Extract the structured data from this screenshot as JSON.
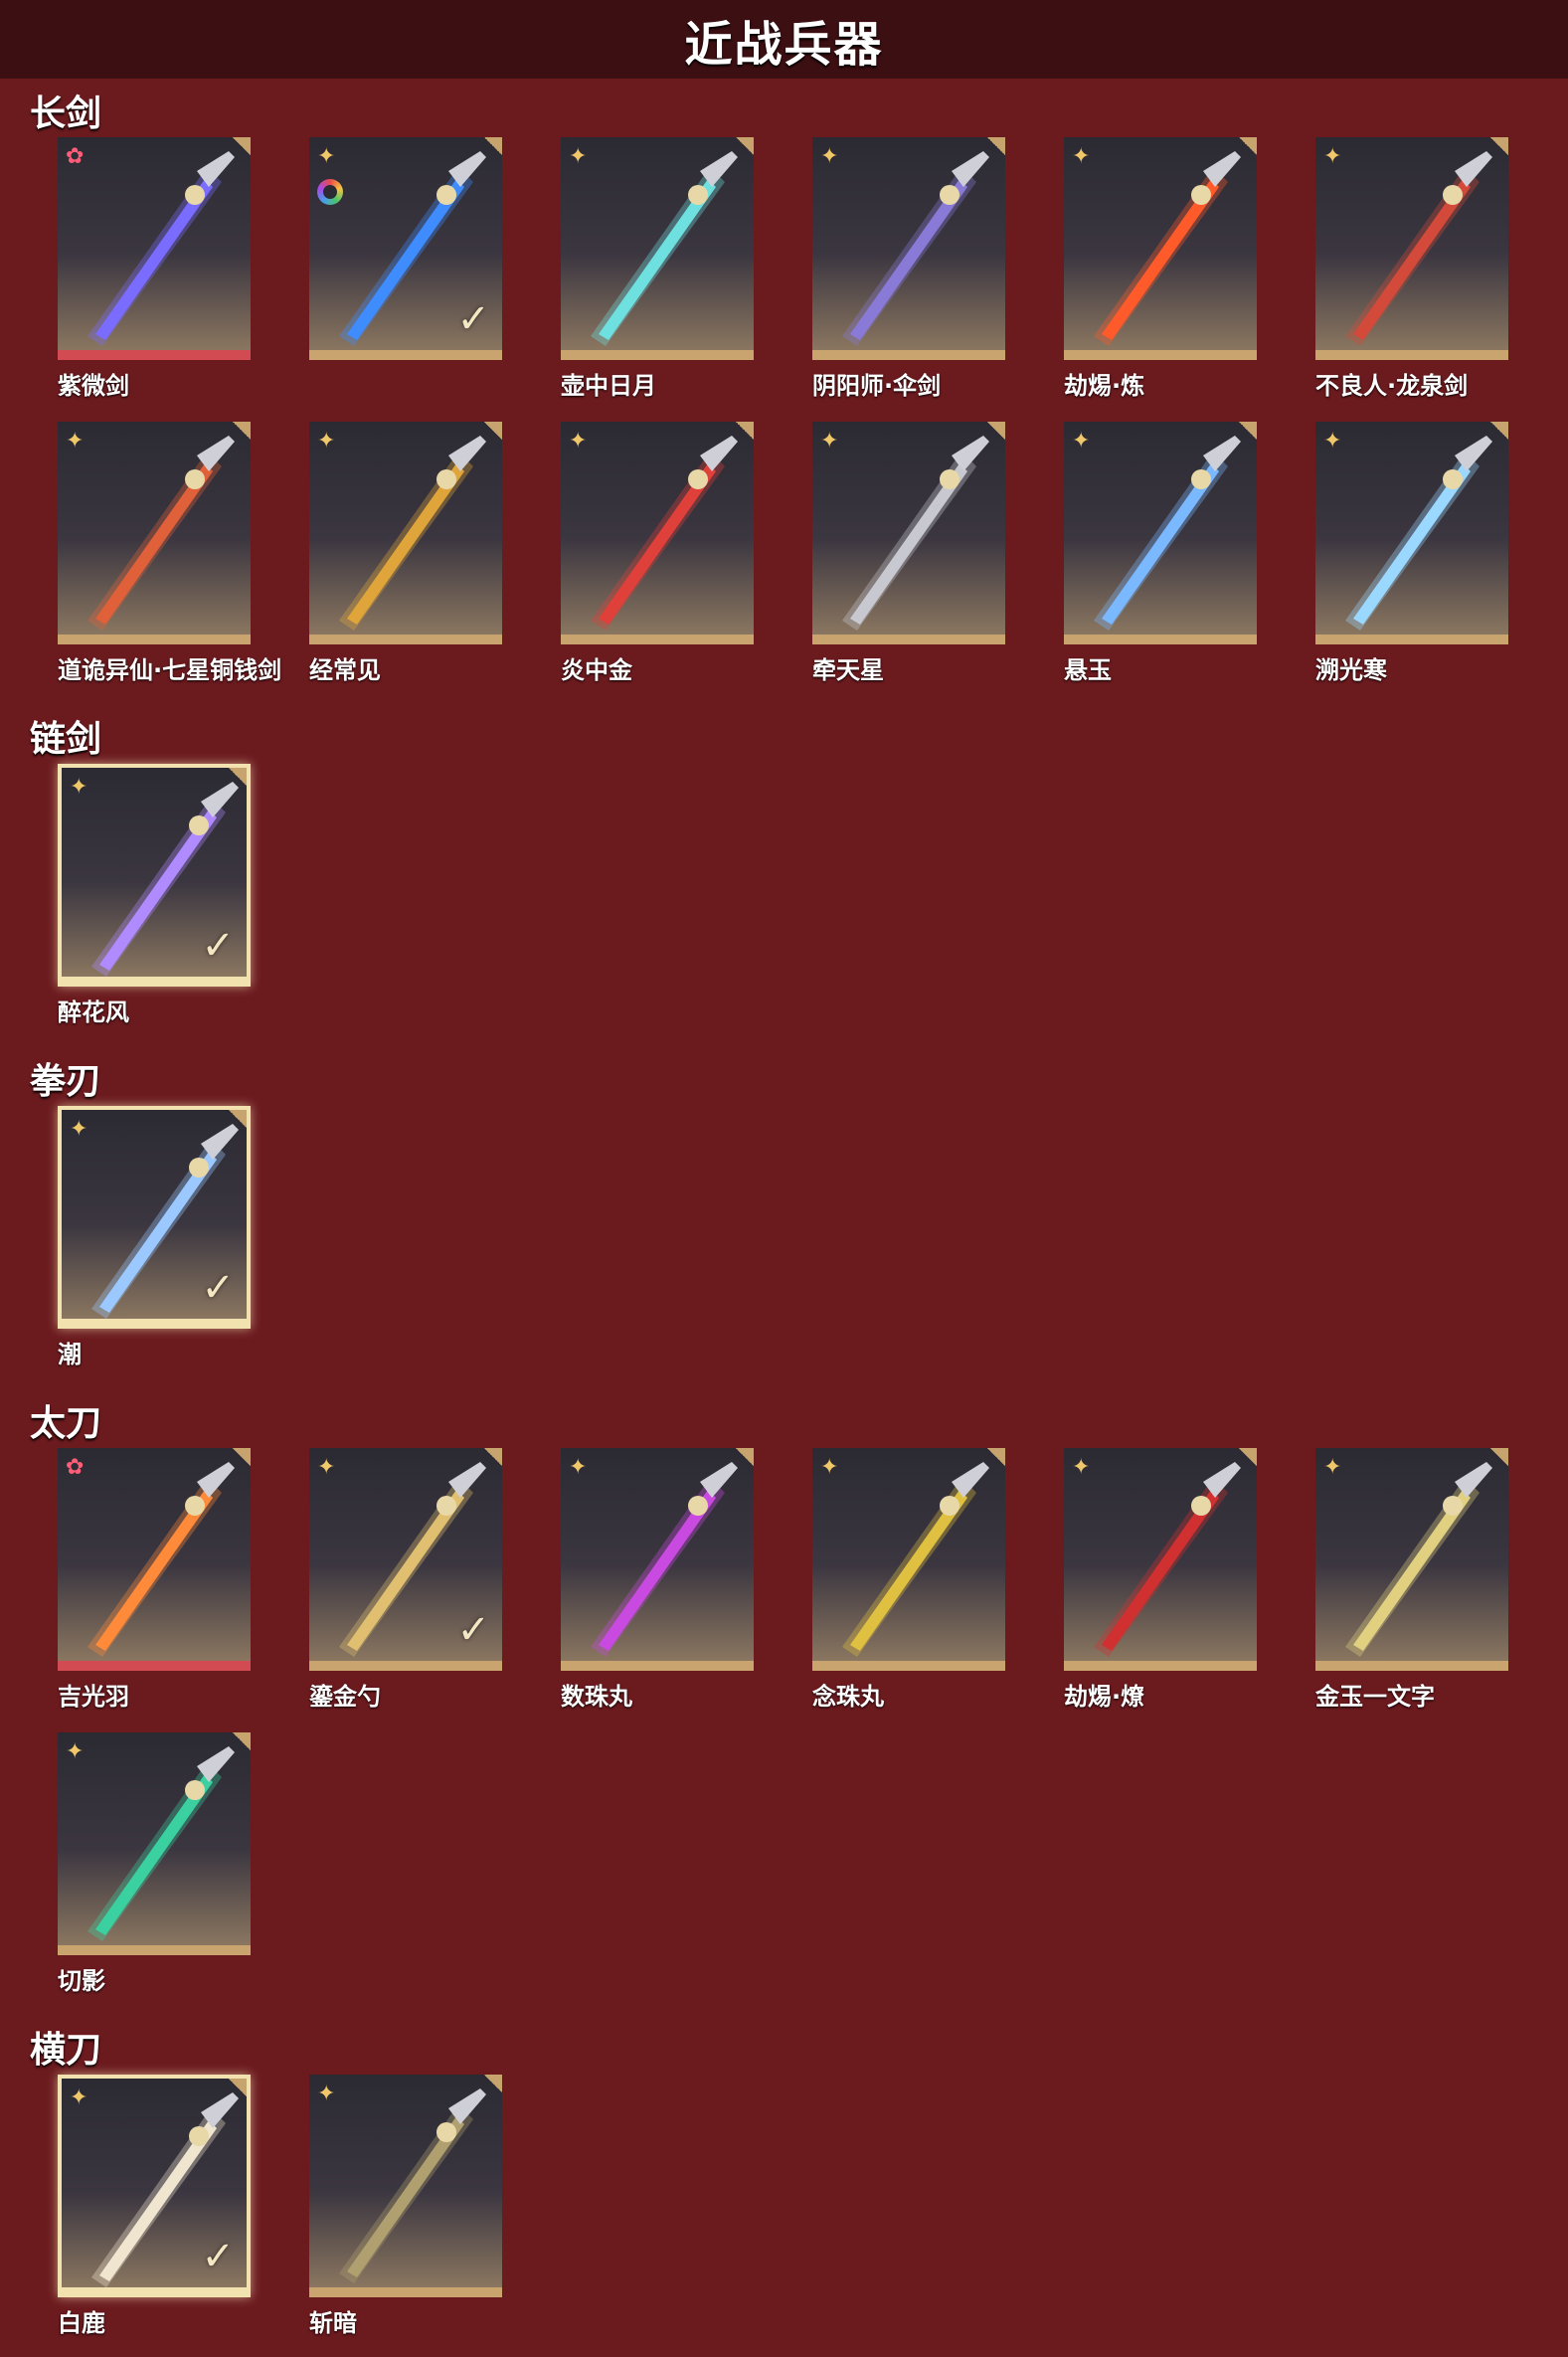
{
  "page_title": "近战兵器",
  "sections": [
    {
      "title": "长剑",
      "items": [
        {
          "name": "紫微剑",
          "rank": "pink",
          "bar": "red",
          "checked": false,
          "ring": false,
          "color": "#7a6cff"
        },
        {
          "name": "",
          "rank": "gold",
          "bar": "gold",
          "checked": true,
          "ring": true,
          "color": "#3f8cff"
        },
        {
          "name": "壶中日月",
          "rank": "gold",
          "bar": "gold",
          "checked": false,
          "ring": false,
          "color": "#6fe0e0"
        },
        {
          "name": "阴阳师·伞剑",
          "rank": "gold",
          "bar": "gold",
          "checked": false,
          "ring": false,
          "color": "#8a7ad8"
        },
        {
          "name": "劫焬·炼",
          "rank": "gold",
          "bar": "gold",
          "checked": false,
          "ring": false,
          "color": "#ff5a2a"
        },
        {
          "name": "不良人·龙泉剑",
          "rank": "gold",
          "bar": "gold",
          "checked": false,
          "ring": false,
          "color": "#d34a3a"
        },
        {
          "name": "道诡异仙·七星铜钱剑",
          "rank": "gold",
          "bar": "gold",
          "checked": false,
          "ring": false,
          "color": "#e0603a"
        },
        {
          "name": "经常见",
          "rank": "gold",
          "bar": "gold",
          "checked": false,
          "ring": false,
          "color": "#e0a53a"
        },
        {
          "name": "炎中金",
          "rank": "gold",
          "bar": "gold",
          "checked": false,
          "ring": false,
          "color": "#e0403a"
        },
        {
          "name": "牵天星",
          "rank": "gold",
          "bar": "gold",
          "checked": false,
          "ring": false,
          "color": "#c8c8d0"
        },
        {
          "name": "悬玉",
          "rank": "gold",
          "bar": "gold",
          "checked": false,
          "ring": false,
          "color": "#7ab8ff"
        },
        {
          "name": "溯光寒",
          "rank": "gold",
          "bar": "gold",
          "checked": false,
          "ring": false,
          "color": "#9ad8ff"
        }
      ]
    },
    {
      "title": "链剑",
      "items": [
        {
          "name": "醉花风",
          "rank": "gold",
          "bar": "gold",
          "checked": true,
          "ring": false,
          "selected": true,
          "color": "#b08aff"
        }
      ]
    },
    {
      "title": "拳刃",
      "items": [
        {
          "name": "潮",
          "rank": "gold",
          "bar": "gold",
          "checked": true,
          "ring": false,
          "selected": true,
          "color": "#9ac8ff"
        }
      ]
    },
    {
      "title": "太刀",
      "items": [
        {
          "name": "吉光羽",
          "rank": "pink",
          "bar": "red",
          "checked": false,
          "ring": false,
          "color": "#ff8a3a"
        },
        {
          "name": "鎏金勺",
          "rank": "gold",
          "bar": "gold",
          "checked": true,
          "ring": false,
          "color": "#e0c070"
        },
        {
          "name": "数珠丸",
          "rank": "gold",
          "bar": "gold",
          "checked": false,
          "ring": false,
          "color": "#c84ae0"
        },
        {
          "name": "念珠丸",
          "rank": "gold",
          "bar": "gold",
          "checked": false,
          "ring": false,
          "color": "#e0c040"
        },
        {
          "name": "劫焬·燎",
          "rank": "gold",
          "bar": "gold",
          "checked": false,
          "ring": false,
          "color": "#d03030"
        },
        {
          "name": "金玉一文字",
          "rank": "gold",
          "bar": "gold",
          "checked": false,
          "ring": false,
          "color": "#e0d080"
        },
        {
          "name": "切影",
          "rank": "gold",
          "bar": "gold",
          "checked": false,
          "ring": false,
          "color": "#3ad0a0"
        }
      ]
    },
    {
      "title": "横刀",
      "items": [
        {
          "name": "白鹿",
          "rank": "gold",
          "bar": "gold",
          "checked": true,
          "ring": false,
          "selected": true,
          "color": "#f0e6d0"
        },
        {
          "name": "斩暗",
          "rank": "gold",
          "bar": "gold",
          "checked": false,
          "ring": false,
          "color": "#b0a070"
        }
      ]
    }
  ]
}
